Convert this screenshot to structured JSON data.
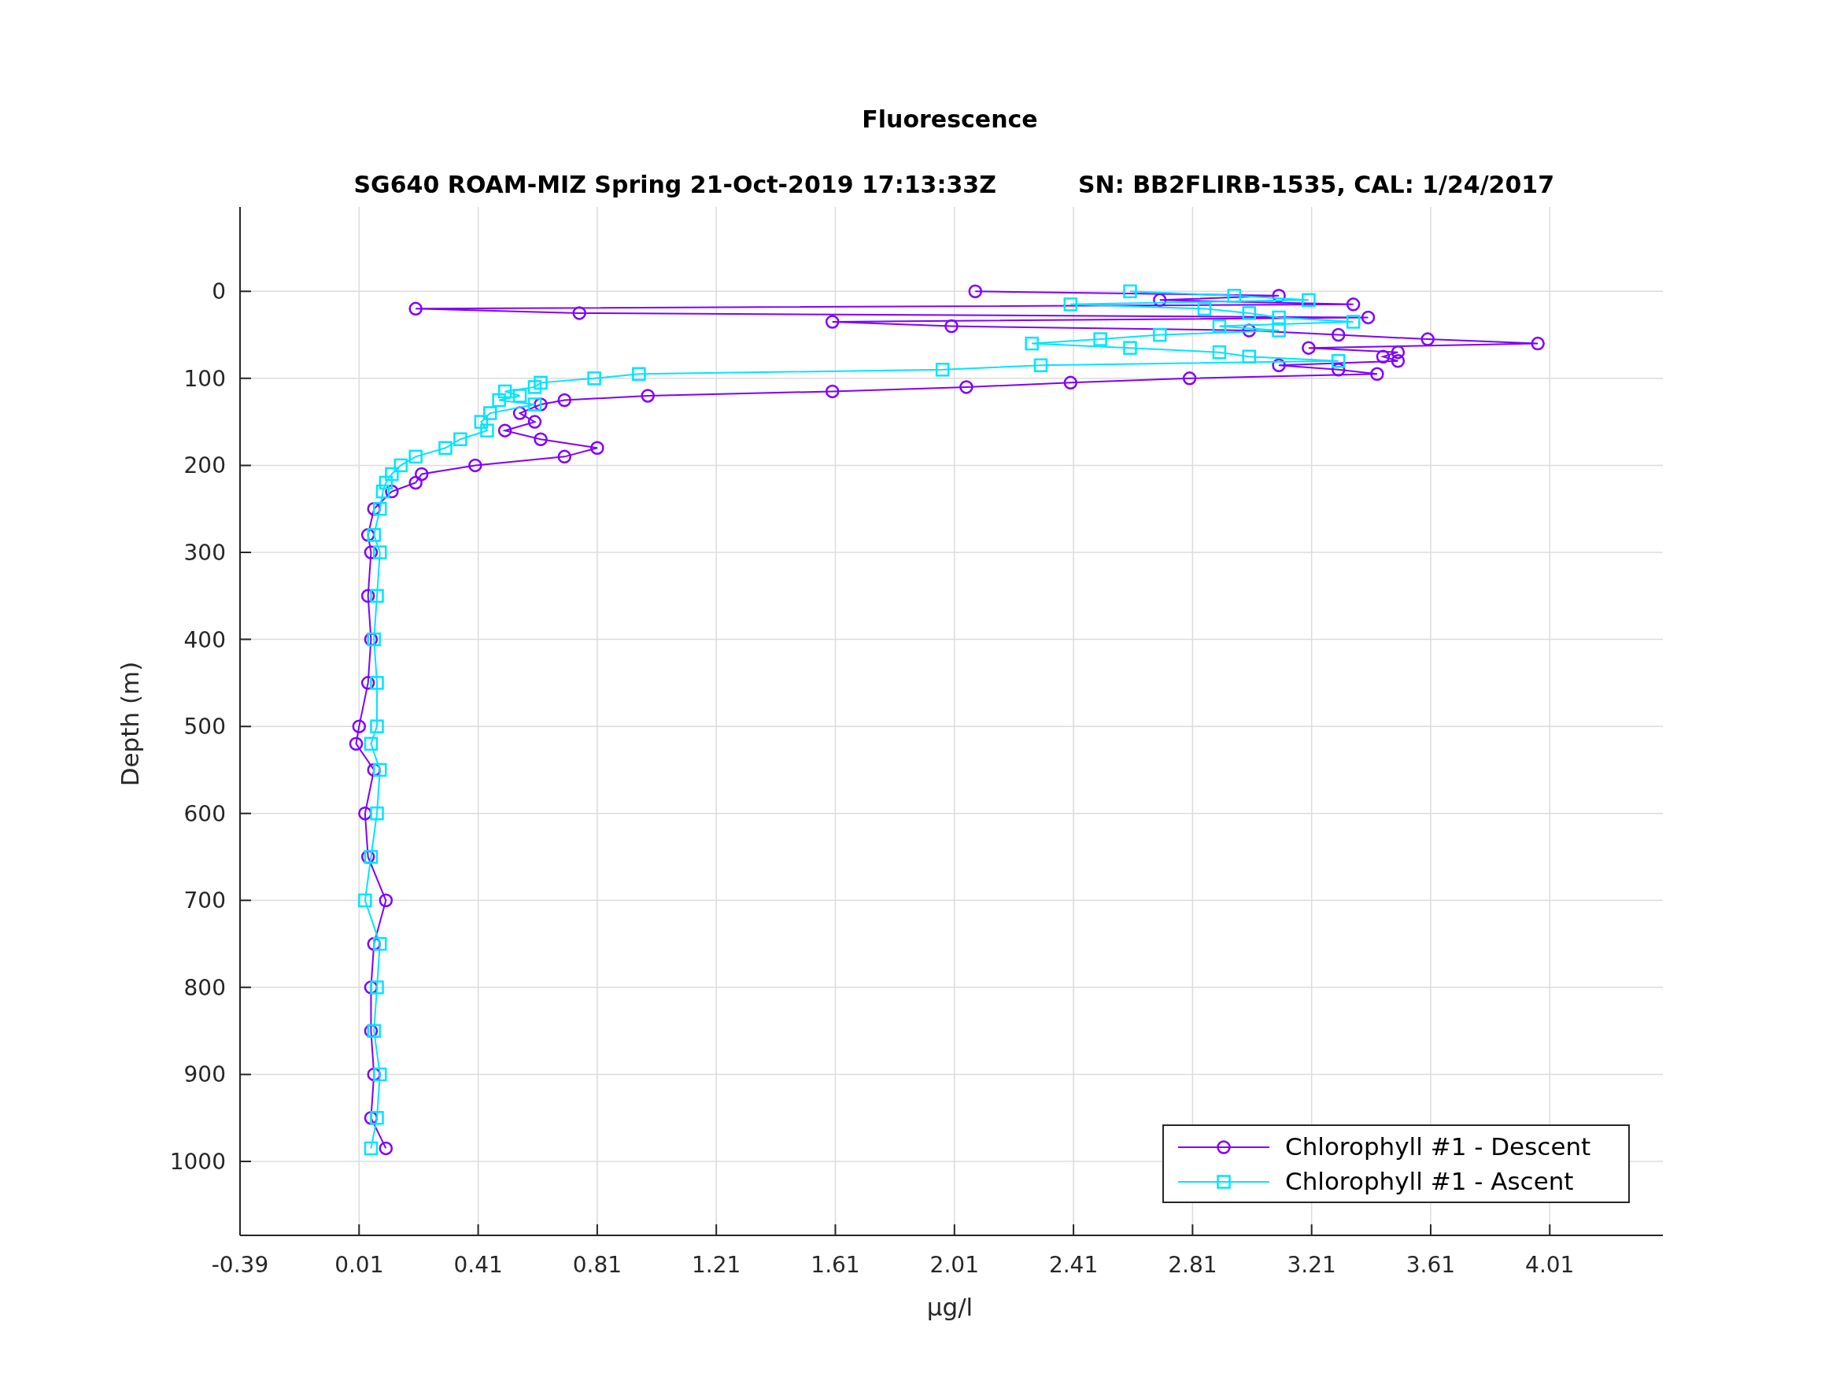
{
  "figure": {
    "title": "Fluorescence",
    "subtitle": [
      "SG640 ROAM-MIZ Spring 21-Oct-2019 17:13:33Z",
      "SN: BB2FLIRB-1535, CAL: 1/24/2017"
    ],
    "chart_data": {
      "type": "line",
      "orientation": "horizontal",
      "xlabel": "μg/l",
      "ylabel": "Depth (m)",
      "x": [
        0,
        5,
        10,
        15,
        20,
        25,
        30,
        35,
        40,
        45,
        50,
        55,
        60,
        65,
        70,
        75,
        80,
        85,
        90,
        95,
        100,
        105,
        110,
        115,
        120,
        125,
        130,
        140,
        150,
        160,
        170,
        180,
        190,
        200,
        210,
        220,
        230,
        250,
        280,
        300,
        350,
        400,
        450,
        500,
        520,
        550,
        600,
        650,
        700,
        750,
        800,
        850,
        900,
        950,
        985
      ],
      "series": [
        {
          "name": "Chlorophyll #1 - Descent",
          "color": "#7f00ff",
          "marker": "circle",
          "values": [
            2.08,
            3.1,
            2.7,
            3.35,
            0.2,
            0.75,
            3.4,
            1.6,
            2.0,
            3.0,
            3.3,
            3.6,
            3.97,
            3.2,
            3.5,
            3.45,
            3.5,
            3.1,
            3.3,
            3.43,
            2.8,
            2.4,
            2.05,
            1.6,
            0.98,
            0.7,
            0.62,
            0.55,
            0.6,
            0.5,
            0.62,
            0.81,
            0.7,
            0.4,
            0.22,
            0.2,
            0.12,
            0.06,
            0.04,
            0.05,
            0.04,
            0.05,
            0.04,
            0.01,
            0.0,
            0.06,
            0.03,
            0.04,
            0.1,
            0.06,
            0.05,
            0.05,
            0.06,
            0.05,
            0.1
          ]
        },
        {
          "name": "Chlorophyll #1 - Ascent",
          "color": "#00e5ff",
          "marker": "square",
          "values": [
            2.6,
            2.95,
            3.2,
            2.4,
            2.85,
            3.0,
            3.1,
            3.35,
            2.9,
            3.1,
            2.7,
            2.5,
            2.27,
            2.6,
            2.9,
            3.0,
            3.3,
            2.3,
            1.97,
            0.95,
            0.8,
            0.62,
            0.6,
            0.5,
            0.55,
            0.48,
            0.6,
            0.45,
            0.42,
            0.44,
            0.35,
            0.3,
            0.2,
            0.15,
            0.12,
            0.1,
            0.09,
            0.08,
            0.06,
            0.08,
            0.07,
            0.06,
            0.07,
            0.07,
            0.05,
            0.08,
            0.07,
            0.05,
            0.03,
            0.08,
            0.07,
            0.06,
            0.08,
            0.07,
            0.05
          ]
        }
      ],
      "xlim": [
        -0.39,
        4.39
      ],
      "ylim": [
        1085,
        -97
      ],
      "grid": true,
      "legend": "lower right",
      "xticks": [
        {
          "value": -0.39,
          "label": "-0.39"
        },
        {
          "value": 0.01,
          "label": "0.01"
        },
        {
          "value": 0.41,
          "label": "0.41"
        },
        {
          "value": 0.81,
          "label": "0.81"
        },
        {
          "value": 1.21,
          "label": "1.21"
        },
        {
          "value": 1.61,
          "label": "1.61"
        },
        {
          "value": 2.01,
          "label": "2.01"
        },
        {
          "value": 2.41,
          "label": "2.41"
        },
        {
          "value": 2.81,
          "label": "2.81"
        },
        {
          "value": 3.21,
          "label": "3.21"
        },
        {
          "value": 3.61,
          "label": "3.61"
        },
        {
          "value": 4.01,
          "label": "4.01"
        }
      ],
      "yticks": [
        0,
        100,
        200,
        300,
        400,
        500,
        600,
        700,
        800,
        900,
        1000
      ]
    }
  }
}
